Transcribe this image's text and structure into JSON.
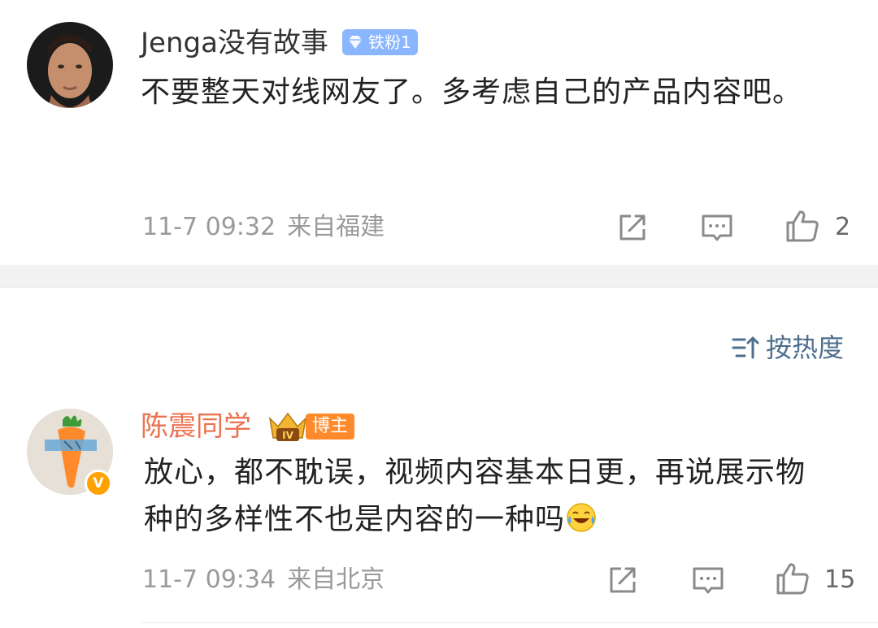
{
  "comments": [
    {
      "username": "Jenga没有故事",
      "badge": "铁粉1",
      "text": "不要整天对线网友了。多考虑自己的产品内容吧。",
      "time": "11-7 09:32",
      "location": "来自福建",
      "likes": "2",
      "avatar_icon": "user-photo-icon"
    },
    {
      "username": "陈震同学",
      "badge": "博主",
      "text": "放心，都不耽误，视频内容基本日更，再说展示物种的多样性不也是内容的一种吗",
      "emoji": "laugh-cry-emoji-icon",
      "time": "11-7 09:34",
      "location": "来自北京",
      "likes": "15",
      "verified_mark": "V"
    }
  ],
  "sort": {
    "label": "按热度",
    "icon": "sort-icon"
  },
  "colors": {
    "username_gray": "#333333",
    "username_orange": "#eb7350",
    "meta": "#9a9a9a",
    "sort_blue": "#4e6f8e",
    "fan_badge": "#8ab6ff",
    "blogger_tag": "#ff8a2b"
  }
}
